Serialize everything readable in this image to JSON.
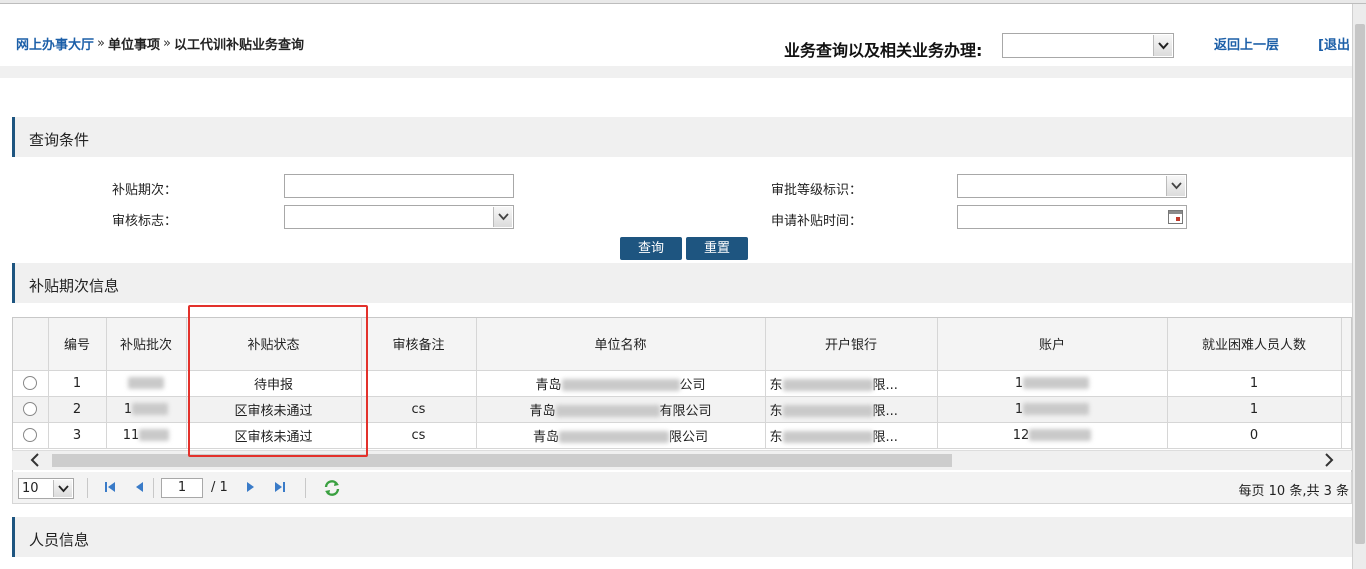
{
  "breadcrumb": {
    "home": "网上办事大厅",
    "sep1": "»",
    "level1": "单位事项",
    "sep2": "»",
    "current": "以工代训补贴业务查询"
  },
  "header": {
    "biz_label": "业务查询以及相关业务办理:",
    "biz_select_value": "",
    "back_link": "返回上一层",
    "exit_link": "[退出"
  },
  "query_section": {
    "title": "查询条件",
    "fields": {
      "period_label": "补贴期次：",
      "period_value": "",
      "approval_level_label": "审批等级标识：",
      "approval_level_value": "",
      "audit_flag_label": "审核标志：",
      "audit_flag_value": "",
      "apply_time_label": "申请补贴时间：",
      "apply_time_value": ""
    },
    "query_button": "查询",
    "reset_button": "重置"
  },
  "period_section": {
    "title": "补贴期次信息"
  },
  "table": {
    "columns": [
      "编号",
      "补贴批次",
      "补贴状态",
      "审核备注",
      "单位名称",
      "开户银行",
      "账户",
      "就业困难人员人数"
    ],
    "rows": [
      {
        "no": "1",
        "batch": "",
        "status": "待申报",
        "remark": "",
        "unit_a": "青岛",
        "unit_b": "公司",
        "bank": "东",
        "bank_tail": "限...",
        "account": "1",
        "count": "1"
      },
      {
        "no": "2",
        "batch": "1",
        "status": "区审核未通过",
        "remark": "cs",
        "unit_a": "青岛",
        "unit_b": "有限公司",
        "bank": "东",
        "bank_tail": "限...",
        "account": "1",
        "count": "1"
      },
      {
        "no": "3",
        "batch": "11",
        "status": "区审核未通过",
        "remark": "cs",
        "unit_a": "青岛",
        "unit_b": "限公司",
        "bank": "东",
        "bank_tail": "限...",
        "account": "12",
        "count": "0"
      }
    ]
  },
  "pager": {
    "page_size": "10",
    "current_page": "1",
    "total_pages": "/ 1",
    "info": "每页 10 条,共 3 条"
  },
  "person_section": {
    "title": "人员信息"
  },
  "colors": {
    "accent": "#1e5580",
    "link": "#1c5fa8",
    "highlight": "#e3312b"
  }
}
